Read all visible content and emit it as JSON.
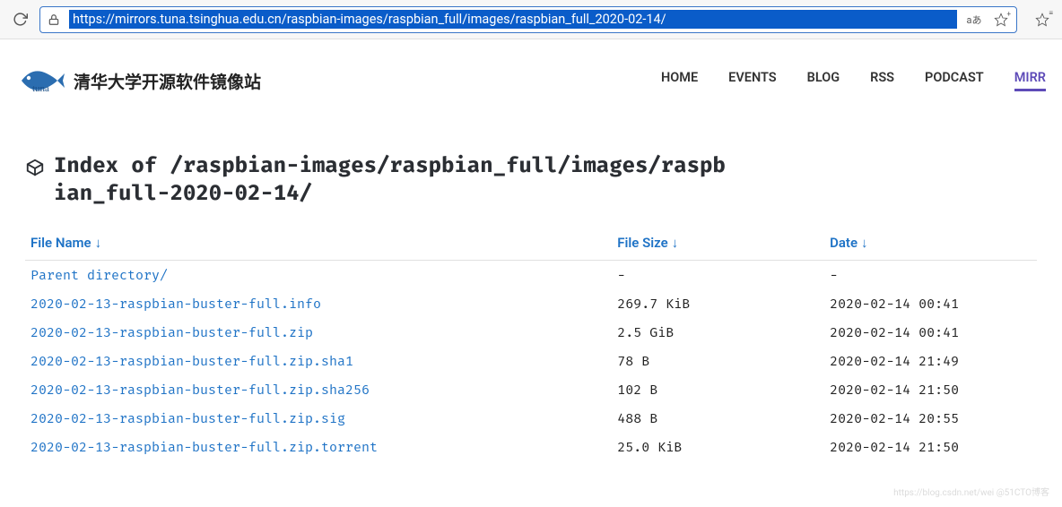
{
  "browser": {
    "url": "https://mirrors.tuna.tsinghua.edu.cn/raspbian-images/raspbian_full/images/raspbian_full_2020-02-14/",
    "reading_mode_label": "aあ"
  },
  "site": {
    "title": "清华大学开源软件镜像站",
    "logo_text": "tuna",
    "nav": {
      "home": "HOME",
      "events": "EVENTS",
      "blog": "BLOG",
      "rss": "RSS",
      "podcast": "PODCAST",
      "mirr": "MIRR"
    }
  },
  "index": {
    "prefix": "Index of ",
    "path": "/raspbian-images/raspbian_full/images/raspbian_full-2020-02-14/"
  },
  "columns": {
    "name": "File Name",
    "size": "File Size",
    "date": "Date",
    "sort_glyph": "↓"
  },
  "rows": [
    {
      "name": "Parent directory/",
      "size": "-",
      "date": "-",
      "highlight": false
    },
    {
      "name": "2020-02-13-raspbian-buster-full.info",
      "size": "269.7 KiB",
      "date": "2020-02-14 00:41",
      "highlight": false
    },
    {
      "name": "2020-02-13-raspbian-buster-full.zip",
      "size": "2.5 GiB",
      "date": "2020-02-14 00:41",
      "highlight": true
    },
    {
      "name": "2020-02-13-raspbian-buster-full.zip.sha1",
      "size": "78 B",
      "date": "2020-02-14 21:49",
      "highlight": false
    },
    {
      "name": "2020-02-13-raspbian-buster-full.zip.sha256",
      "size": "102 B",
      "date": "2020-02-14 21:50",
      "highlight": false
    },
    {
      "name": "2020-02-13-raspbian-buster-full.zip.sig",
      "size": "488 B",
      "date": "2020-02-14 20:55",
      "highlight": false
    },
    {
      "name": "2020-02-13-raspbian-buster-full.zip.torrent",
      "size": "25.0 KiB",
      "date": "2020-02-14 21:50",
      "highlight": false
    }
  ],
  "watermark": "https://blog.csdn.net/wei @51CTO博客"
}
